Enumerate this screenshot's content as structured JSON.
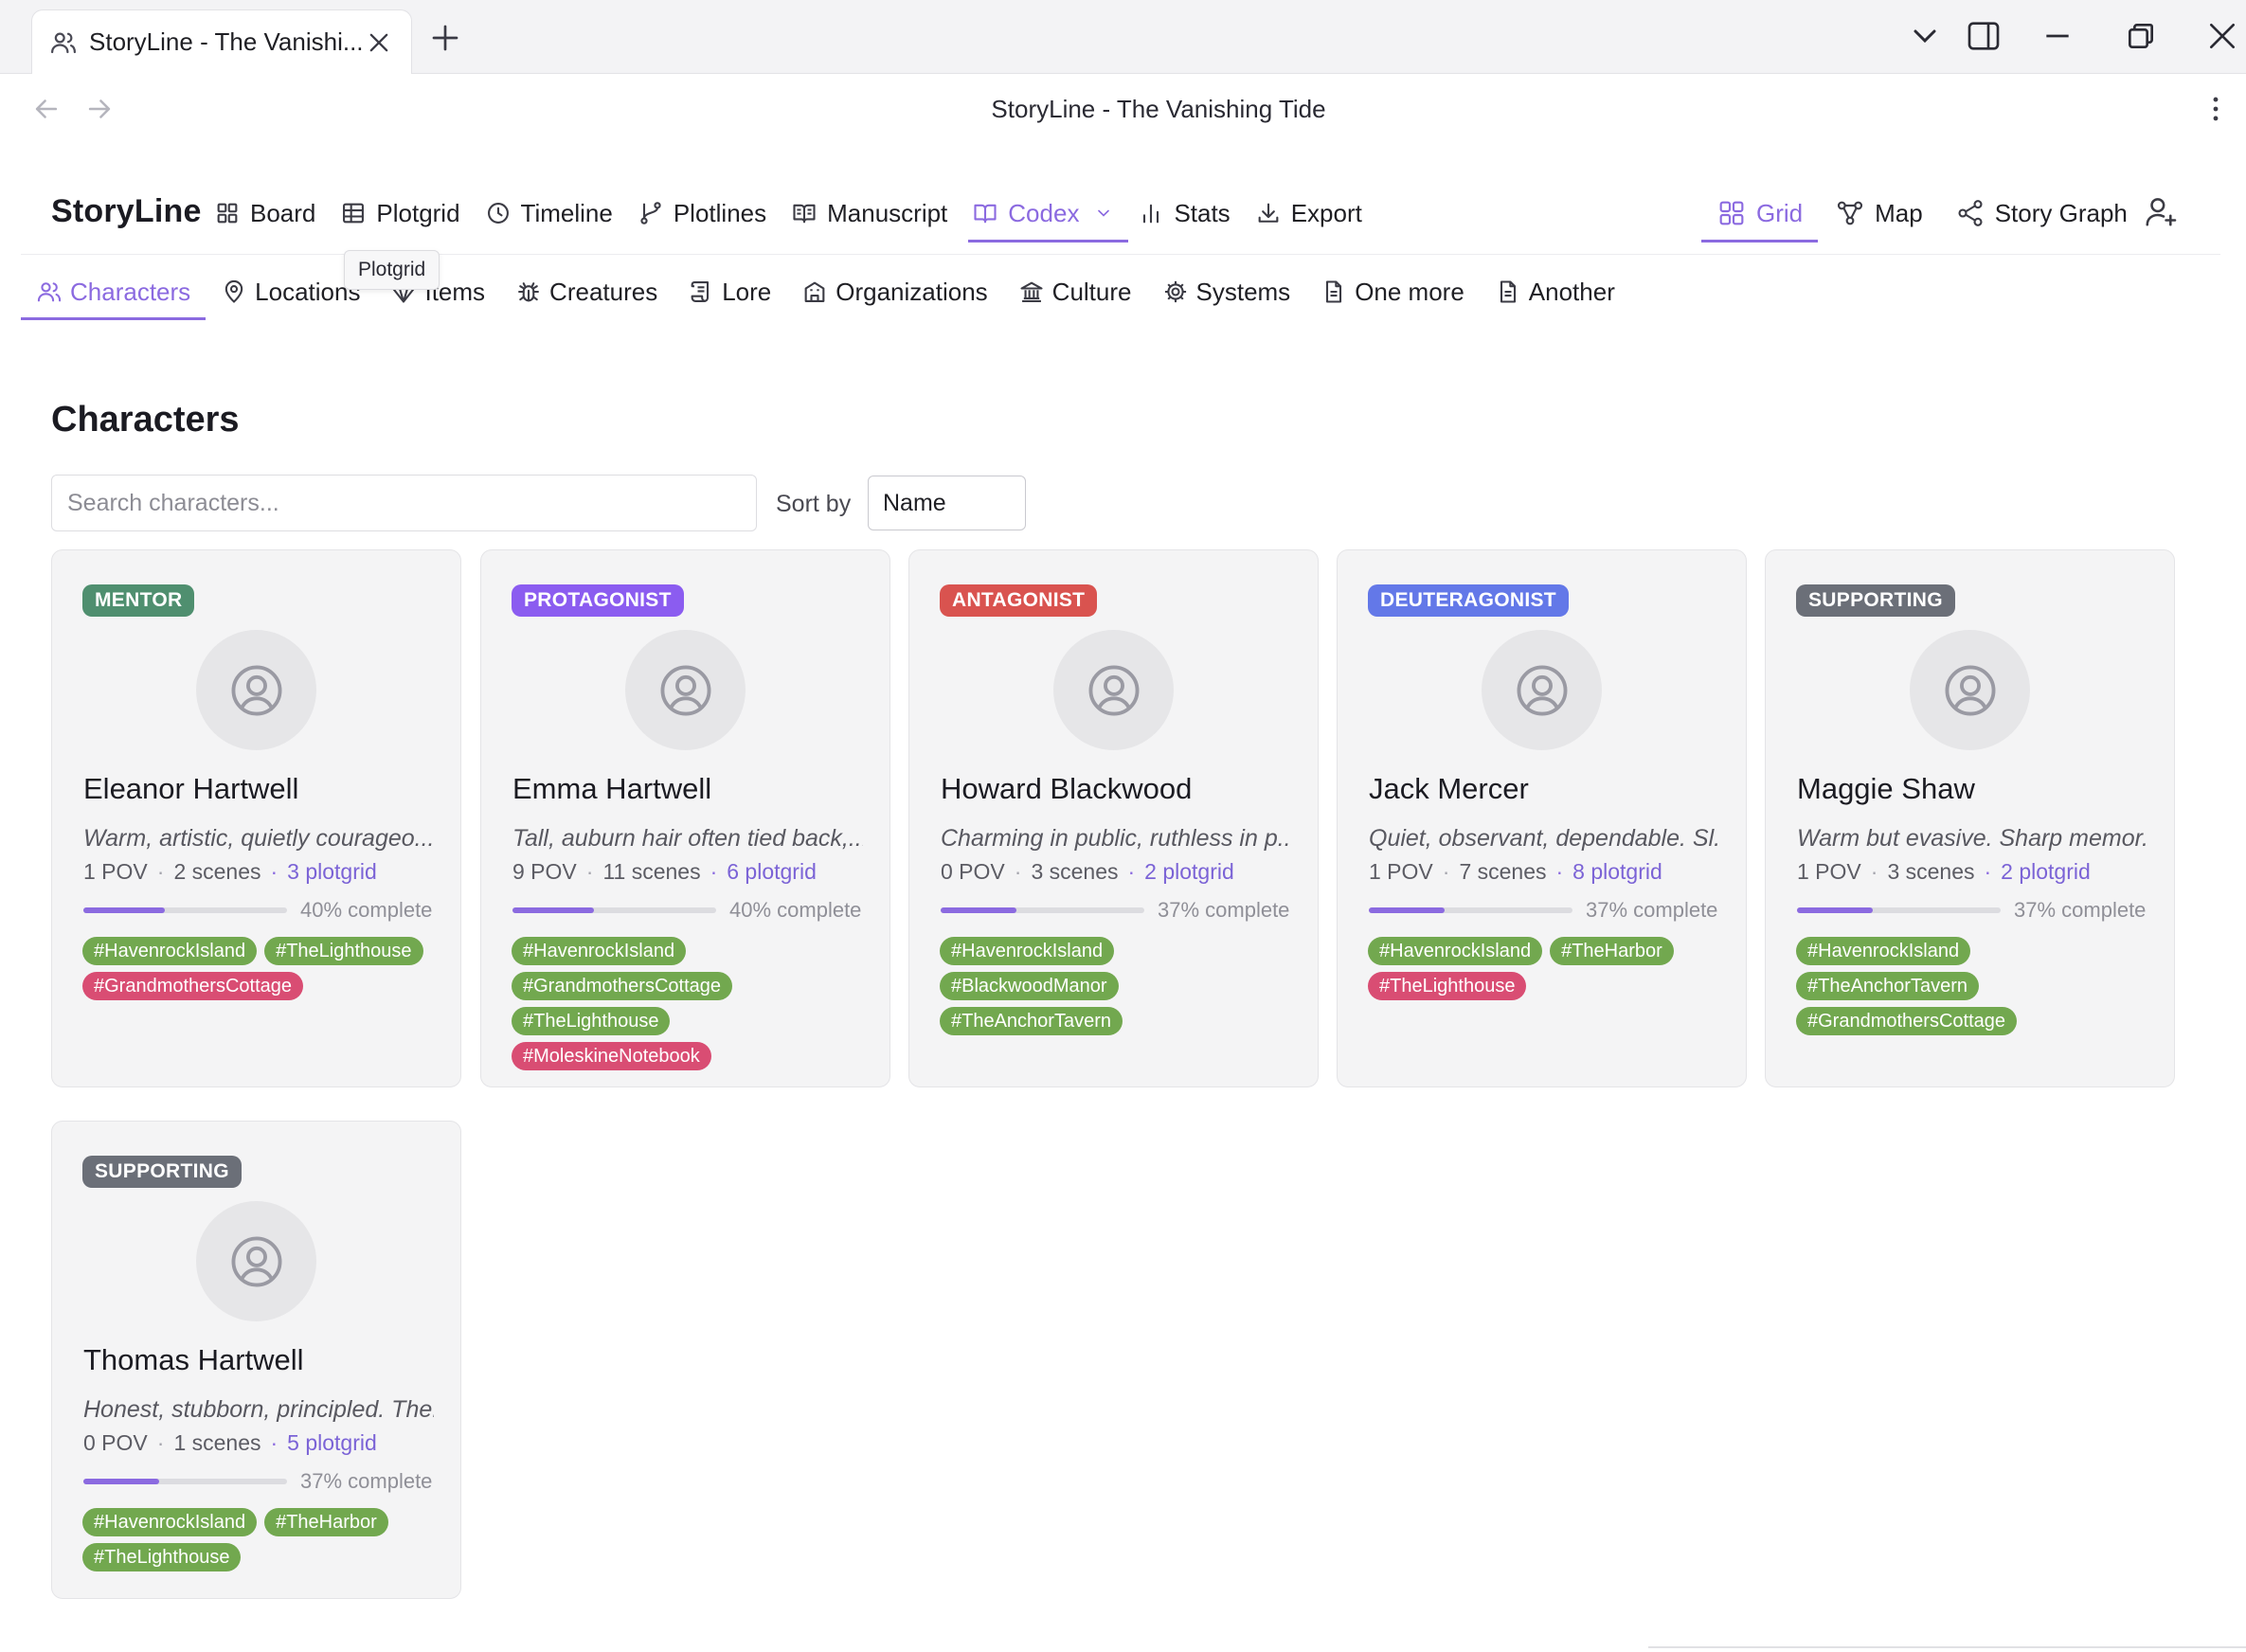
{
  "browser": {
    "tab_title": "StoryLine - The Vanishi...",
    "window_title": "StoryLine - The Vanishing Tide"
  },
  "app": {
    "name": "StoryLine",
    "accent_color": "#8b6ae0"
  },
  "main_nav": [
    {
      "label": "Board",
      "icon": "board-grid-icon"
    },
    {
      "label": "Plotgrid",
      "icon": "table-icon"
    },
    {
      "label": "Timeline",
      "icon": "clock-icon"
    },
    {
      "label": "Plotlines",
      "icon": "branch-icon"
    },
    {
      "label": "Manuscript",
      "icon": "open-book-icon"
    },
    {
      "label": "Codex",
      "icon": "book-icon",
      "active": true
    },
    {
      "label": "Stats",
      "icon": "bar-chart-icon"
    },
    {
      "label": "Export",
      "icon": "download-icon"
    }
  ],
  "view_nav": [
    {
      "label": "Grid",
      "icon": "grid-icon",
      "active": true
    },
    {
      "label": "Map",
      "icon": "map-nodes-icon"
    },
    {
      "label": "Story Graph",
      "icon": "share-graph-icon"
    }
  ],
  "tooltip": "Plotgrid",
  "sub_nav": [
    {
      "label": "Characters",
      "icon": "users-icon",
      "active": true
    },
    {
      "label": "Locations",
      "icon": "map-pin-icon"
    },
    {
      "label": "Items",
      "icon": "gem-icon"
    },
    {
      "label": "Creatures",
      "icon": "bug-icon"
    },
    {
      "label": "Lore",
      "icon": "scroll-icon"
    },
    {
      "label": "Organizations",
      "icon": "building-icon"
    },
    {
      "label": "Culture",
      "icon": "landmark-icon"
    },
    {
      "label": "Systems",
      "icon": "cog-icon"
    },
    {
      "label": "One more",
      "icon": "document-icon"
    },
    {
      "label": "Another",
      "icon": "document-icon"
    }
  ],
  "page": {
    "title": "Characters",
    "search_placeholder": "Search characters...",
    "sort_label": "Sort by",
    "sort_value": "Name"
  },
  "role_colors": {
    "MENTOR": "#4f8f6f",
    "PROTAGONIST": "#8b5cf0",
    "ANTAGONIST": "#d9534f",
    "DEUTERAGONIST": "#6378e8",
    "SUPPORTING": "#6b6f78"
  },
  "characters": [
    {
      "role": "MENTOR",
      "name": "Eleanor Hartwell",
      "description": "Warm, artistic, quietly courageo...",
      "pov": "1 POV",
      "scenes": "2 scenes",
      "plotgrid": "3 plotgrid",
      "progress": 0.4,
      "progress_label": "40% complete",
      "tags": [
        {
          "text": "#HavenrockIsland",
          "kind": "location"
        },
        {
          "text": "#TheLighthouse",
          "kind": "location"
        },
        {
          "text": "#GrandmothersCottage",
          "kind": "item"
        }
      ]
    },
    {
      "role": "PROTAGONIST",
      "name": "Emma Hartwell",
      "description": "Tall, auburn hair often tied back,...",
      "pov": "9 POV",
      "scenes": "11 scenes",
      "plotgrid": "6 plotgrid",
      "progress": 0.4,
      "progress_label": "40% complete",
      "tags": [
        {
          "text": "#HavenrockIsland",
          "kind": "location"
        },
        {
          "text": "#GrandmothersCottage",
          "kind": "location"
        },
        {
          "text": "#TheLighthouse",
          "kind": "location"
        },
        {
          "text": "#MoleskineNotebook",
          "kind": "item"
        }
      ]
    },
    {
      "role": "ANTAGONIST",
      "name": "Howard Blackwood",
      "description": "Charming in public, ruthless in p...",
      "pov": "0 POV",
      "scenes": "3 scenes",
      "plotgrid": "2 plotgrid",
      "progress": 0.37,
      "progress_label": "37% complete",
      "tags": [
        {
          "text": "#HavenrockIsland",
          "kind": "location"
        },
        {
          "text": "#BlackwoodManor",
          "kind": "location"
        },
        {
          "text": "#TheAnchorTavern",
          "kind": "location"
        }
      ]
    },
    {
      "role": "DEUTERAGONIST",
      "name": "Jack Mercer",
      "description": "Quiet, observant, dependable. Sl...",
      "pov": "1 POV",
      "scenes": "7 scenes",
      "plotgrid": "8 plotgrid",
      "progress": 0.37,
      "progress_label": "37% complete",
      "tags": [
        {
          "text": "#HavenrockIsland",
          "kind": "location"
        },
        {
          "text": "#TheHarbor",
          "kind": "location"
        },
        {
          "text": "#TheLighthouse",
          "kind": "item"
        }
      ]
    },
    {
      "role": "SUPPORTING",
      "name": "Maggie Shaw",
      "description": "Warm but evasive. Sharp memor...",
      "pov": "1 POV",
      "scenes": "3 scenes",
      "plotgrid": "2 plotgrid",
      "progress": 0.37,
      "progress_label": "37% complete",
      "tags": [
        {
          "text": "#HavenrockIsland",
          "kind": "location"
        },
        {
          "text": "#TheAnchorTavern",
          "kind": "location"
        },
        {
          "text": "#GrandmothersCottage",
          "kind": "location"
        }
      ]
    },
    {
      "role": "SUPPORTING",
      "name": "Thomas Hartwell",
      "description": "Honest, stubborn, principled. The...",
      "pov": "0 POV",
      "scenes": "1 scenes",
      "plotgrid": "5 plotgrid",
      "progress": 0.37,
      "progress_label": "37% complete",
      "tags": [
        {
          "text": "#HavenrockIsland",
          "kind": "location"
        },
        {
          "text": "#TheHarbor",
          "kind": "location"
        },
        {
          "text": "#TheLighthouse",
          "kind": "location"
        }
      ]
    }
  ]
}
